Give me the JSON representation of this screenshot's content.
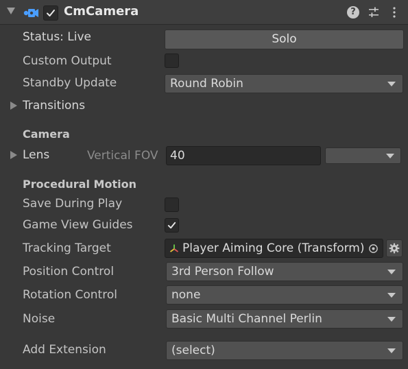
{
  "header": {
    "title": "CmCamera",
    "enabled": true
  },
  "status": {
    "label": "Status: Live",
    "solo_button": "Solo"
  },
  "custom_output": {
    "label": "Custom Output",
    "checked": false
  },
  "standby_update": {
    "label": "Standby Update",
    "value": "Round Robin"
  },
  "transitions": {
    "label": "Transitions"
  },
  "camera_section": {
    "title": "Camera"
  },
  "lens": {
    "label": "Lens",
    "fov_label": "Vertical FOV",
    "fov_value": "40"
  },
  "procedural_section": {
    "title": "Procedural Motion"
  },
  "save_during_play": {
    "label": "Save During Play",
    "checked": false
  },
  "game_view_guides": {
    "label": "Game View Guides",
    "checked": true
  },
  "tracking_target": {
    "label": "Tracking Target",
    "value": "Player Aiming Core (Transform)"
  },
  "position_control": {
    "label": "Position Control",
    "value": "3rd Person Follow"
  },
  "rotation_control": {
    "label": "Rotation Control",
    "value": "none"
  },
  "noise": {
    "label": "Noise",
    "value": "Basic Multi Channel Perlin"
  },
  "add_extension": {
    "label": "Add Extension",
    "value": "(select)"
  }
}
